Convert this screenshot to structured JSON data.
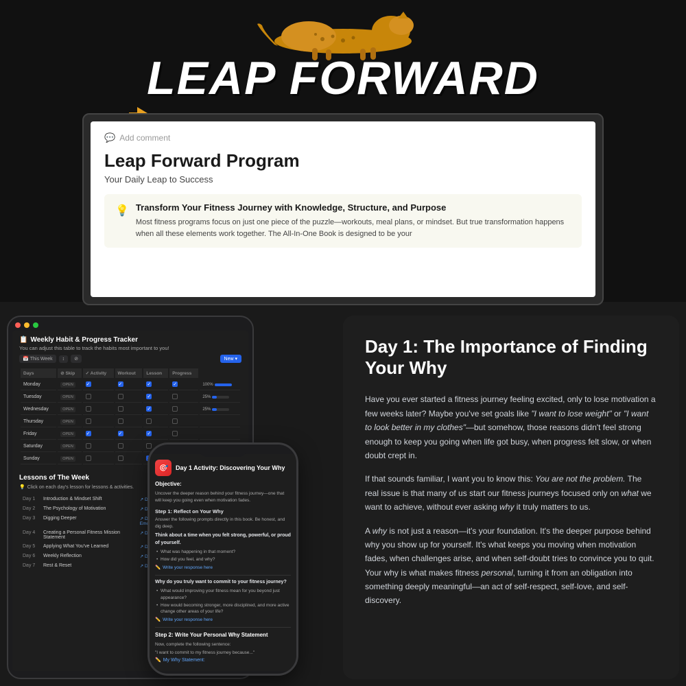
{
  "hero": {
    "title": "LEAP FORWARD",
    "arrow_visible": true
  },
  "desktop": {
    "add_comment": "Add comment",
    "program_title": "Leap Forward Program",
    "program_subtitle": "Your Daily Leap to Success",
    "callout_title": "Transform Your Fitness Journey with Knowledge, Structure, and Purpose",
    "callout_body": "Most fitness programs focus on just one piece of the puzzle—workouts, meal plans, or mindset. But true transformation happens when all these elements work together. The All-In-One Book is designed to be your"
  },
  "tablet": {
    "title": "Weekly Habit & Progress Tracker",
    "subtitle": "You can adjust this table to track the habits most important to you!",
    "controls": {
      "this_week": "This Week",
      "new_btn": "New"
    },
    "columns": [
      "Days",
      "Skip",
      "Activity",
      "Workout",
      "Lesson",
      "Progress"
    ],
    "rows": [
      {
        "day": "Monday",
        "status": "OPEN",
        "checks": [
          true,
          true,
          true,
          true
        ],
        "progress": "100%",
        "fill": 100
      },
      {
        "day": "Tuesday",
        "status": "OPEN",
        "checks": [
          false,
          false,
          true,
          false
        ],
        "progress": "25%",
        "fill": 25
      },
      {
        "day": "Wednesday",
        "status": "OPEN",
        "checks": [
          false,
          false,
          true,
          false
        ],
        "progress": "25%",
        "fill": 25
      },
      {
        "day": "Thursday",
        "status": "OPEN",
        "checks": [
          false,
          false,
          false,
          false
        ],
        "progress": "",
        "fill": 0
      },
      {
        "day": "Friday",
        "status": "OPEN",
        "checks": [
          true,
          true,
          true,
          false
        ],
        "progress": "",
        "fill": 0
      },
      {
        "day": "Saturday",
        "status": "OPEN",
        "checks": [
          false,
          false,
          false,
          false
        ],
        "progress": "",
        "fill": 0
      },
      {
        "day": "Sunday",
        "status": "OPEN",
        "checks": [
          false,
          false,
          true,
          false
        ],
        "progress": "",
        "fill": 0
      }
    ],
    "lessons_title": "Lessons of The Week",
    "lessons_hint": "Click on each day's lesson for lessons & activities.",
    "lessons": [
      {
        "day": "Day 1",
        "title": "Introduction & Mindset Shift",
        "link": "Day 1: The Importance of Finding your why"
      },
      {
        "day": "Day 2",
        "title": "The Psychology of Motivation",
        "link": "Day 2: Instinctive vs. Drive"
      },
      {
        "day": "Day 3",
        "title": "Digging Deeper",
        "link": "Day 3: Connecting Fitness, Your Identity & Emotions"
      },
      {
        "day": "Day 4",
        "title": "Creating a Personal Fitness Mission Statement",
        "link": "Day 4: Fitness Mission Statement"
      },
      {
        "day": "Day 5",
        "title": "Applying What You've Learned",
        "link": "Day 6: Challenge & Self Assessment"
      },
      {
        "day": "Day 6",
        "title": "Weekly Reflection",
        "link": "Day 6: Reflection & Adjustments"
      },
      {
        "day": "Day 7",
        "title": "Rest & Reset",
        "link": "Day 7: Self-Care & Rest Day"
      }
    ]
  },
  "phone": {
    "icon": "🎯",
    "title": "Day 1 Activity: Discovering Your Why",
    "objective_label": "Objective:",
    "objective_text": "Uncover the deeper reason behind your fitness journey—one that will keep you going even when motivation fades.",
    "step1_title": "Step 1: Reflect on Your Why",
    "step1_desc": "Answer the following prompts directly in this book. Be honest, and dig deep.",
    "think_prompt": "Think about a time when you felt strong, powerful, or proud of yourself.",
    "bullets": [
      "What was happening in that moment?",
      "How did you feel, and why?"
    ],
    "write_here": "Write your response here",
    "question_title": "Why do you truly want to commit to your fitness journey?",
    "question_bullets": [
      "What would improving your fitness mean for you beyond just appearance?",
      "How would becoming stronger, more disciplined, and more active change other areas of your life?"
    ],
    "write_response": "Write your response here",
    "step2_title": "Step 2: Write Your Personal Why Statement",
    "step2_desc": "Now, complete the following sentence:",
    "sentence": "\"I want to commit to my fitness journey because...\"",
    "my_why": "My Why Statement:"
  },
  "reading": {
    "title": "Day 1: The Importance of Finding Your Why",
    "para1": "Have you ever started a fitness journey feeling excited, only to lose motivation a few weeks later? Maybe you've set goals like \"I want to lose weight\" or \"I want to look better in my clothes\"—but somehow, those reasons didn't feel strong enough to keep you going when life got busy, when progress felt slow, or when doubt crept in.",
    "para2": "If that sounds familiar, I want you to know this: You are not the problem. The real issue is that many of us start our fitness journeys focused only on what we want to achieve, without ever asking why it truly matters to us.",
    "para3": "A why is not just a reason—it's your foundation. It's the deeper purpose behind why you show up for yourself. It's what keeps you moving when motivation fades, when challenges arise, and when self-doubt tries to convince you to quit. Your why is what makes fitness personal, turning it from an obligation into something deeply meaningful—an act of self-respect, self-love, and self-discovery."
  }
}
